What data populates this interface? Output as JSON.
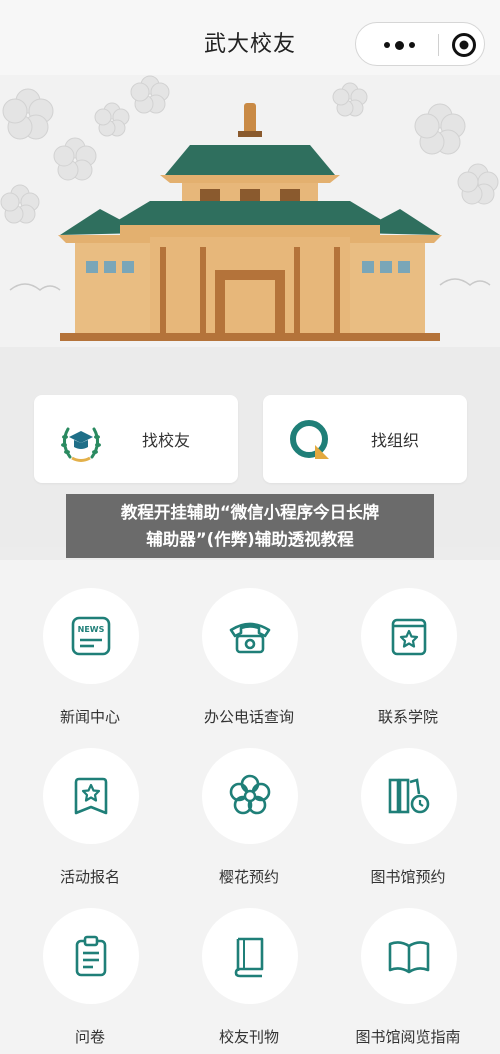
{
  "nav": {
    "title": "武大校友"
  },
  "quick": [
    {
      "label": "找校友",
      "icon": "graduation-cap-laurel-icon"
    },
    {
      "label": "找组织",
      "icon": "q-logo-icon"
    }
  ],
  "overlay": {
    "line1": "教程开挂辅助“微信小程序今日长牌",
    "line2": "辅助器”(作弊)辅助透视教程"
  },
  "grid": [
    {
      "label": "新闻中心",
      "icon": "news-icon"
    },
    {
      "label": "办公电话查询",
      "icon": "telephone-icon"
    },
    {
      "label": "联系学院",
      "icon": "contact-book-icon"
    },
    {
      "label": "活动报名",
      "icon": "star-badge-icon"
    },
    {
      "label": "樱花预约",
      "icon": "cherry-blossom-icon"
    },
    {
      "label": "图书馆预约",
      "icon": "library-books-clock-icon"
    },
    {
      "label": "问卷",
      "icon": "clipboard-icon"
    },
    {
      "label": "校友刊物",
      "icon": "book-icon"
    },
    {
      "label": "图书馆阅览指南",
      "icon": "open-book-icon"
    }
  ],
  "colors": {
    "teal": "#1f7f78",
    "gold": "#e3b06f",
    "roof": "#2f6f5e"
  }
}
